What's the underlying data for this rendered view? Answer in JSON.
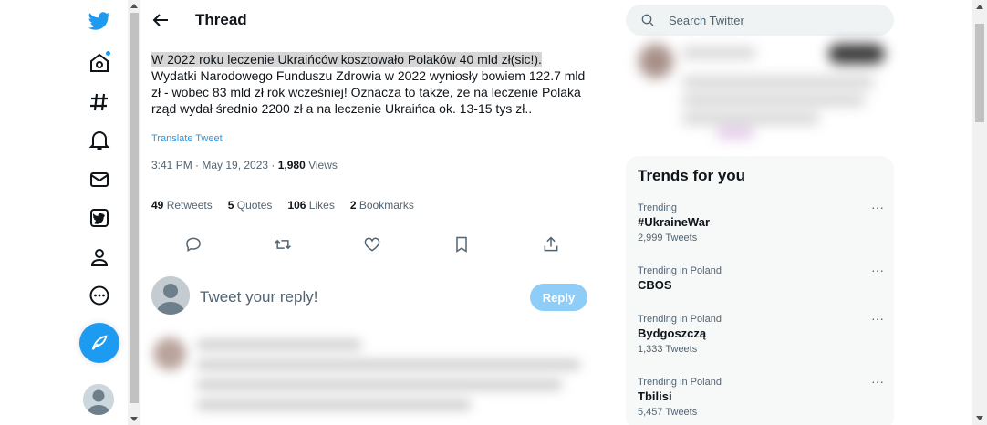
{
  "header": {
    "title": "Thread"
  },
  "tweet": {
    "text_highlighted": "W 2022 roku leczenie Ukraińców kosztowało Polaków 40 mld zł(sic!).",
    "text_rest": " Wydatki Narodowego Funduszu Zdrowia w 2022 wyniosły bowiem 122.7 mld zł - wobec 83 mld zł rok wcześniej! Oznacza to także, że na leczenie Polaka rząd wydał średnio 2200 zł a na leczenie Ukraińca ok. 13-15 tys zł..",
    "translate_label": "Translate Tweet",
    "time": "3:41 PM · May 19, 2023 · ",
    "views_count": "1,980",
    "views_label": " Views",
    "stats": {
      "retweets_count": "49",
      "retweets_label": " Retweets",
      "quotes_count": "5",
      "quotes_label": " Quotes",
      "likes_count": "106",
      "likes_label": " Likes",
      "bookmarks_count": "2",
      "bookmarks_label": " Bookmarks"
    }
  },
  "reply": {
    "placeholder": "Tweet your reply!",
    "button_label": "Reply"
  },
  "search": {
    "placeholder": "Search Twitter"
  },
  "trends": {
    "title": "Trends for you",
    "items": [
      {
        "context": "Trending",
        "name": "#UkraineWar",
        "count": "2,999 Tweets"
      },
      {
        "context": "Trending in Poland",
        "name": "CBOS",
        "count": ""
      },
      {
        "context": "Trending in Poland",
        "name": "Bydgoszczą",
        "count": "1,333 Tweets"
      },
      {
        "context": "Trending in Poland",
        "name": "Tbilisi",
        "count": "5,457 Tweets"
      }
    ],
    "more_label": "···"
  },
  "colors": {
    "accent": "#1d9bf0",
    "reply_button": "#8ecdf7",
    "text": "#0f1419",
    "muted": "#536471"
  },
  "icons": [
    "twitter-logo-icon",
    "home-icon",
    "explore-hashtag-icon",
    "notifications-bell-icon",
    "messages-envelope-icon",
    "verified-icon",
    "profile-icon",
    "more-circle-icon",
    "compose-feather-icon",
    "back-arrow-icon",
    "reply-icon",
    "retweet-icon",
    "like-heart-icon",
    "bookmark-icon",
    "share-icon",
    "search-icon"
  ]
}
